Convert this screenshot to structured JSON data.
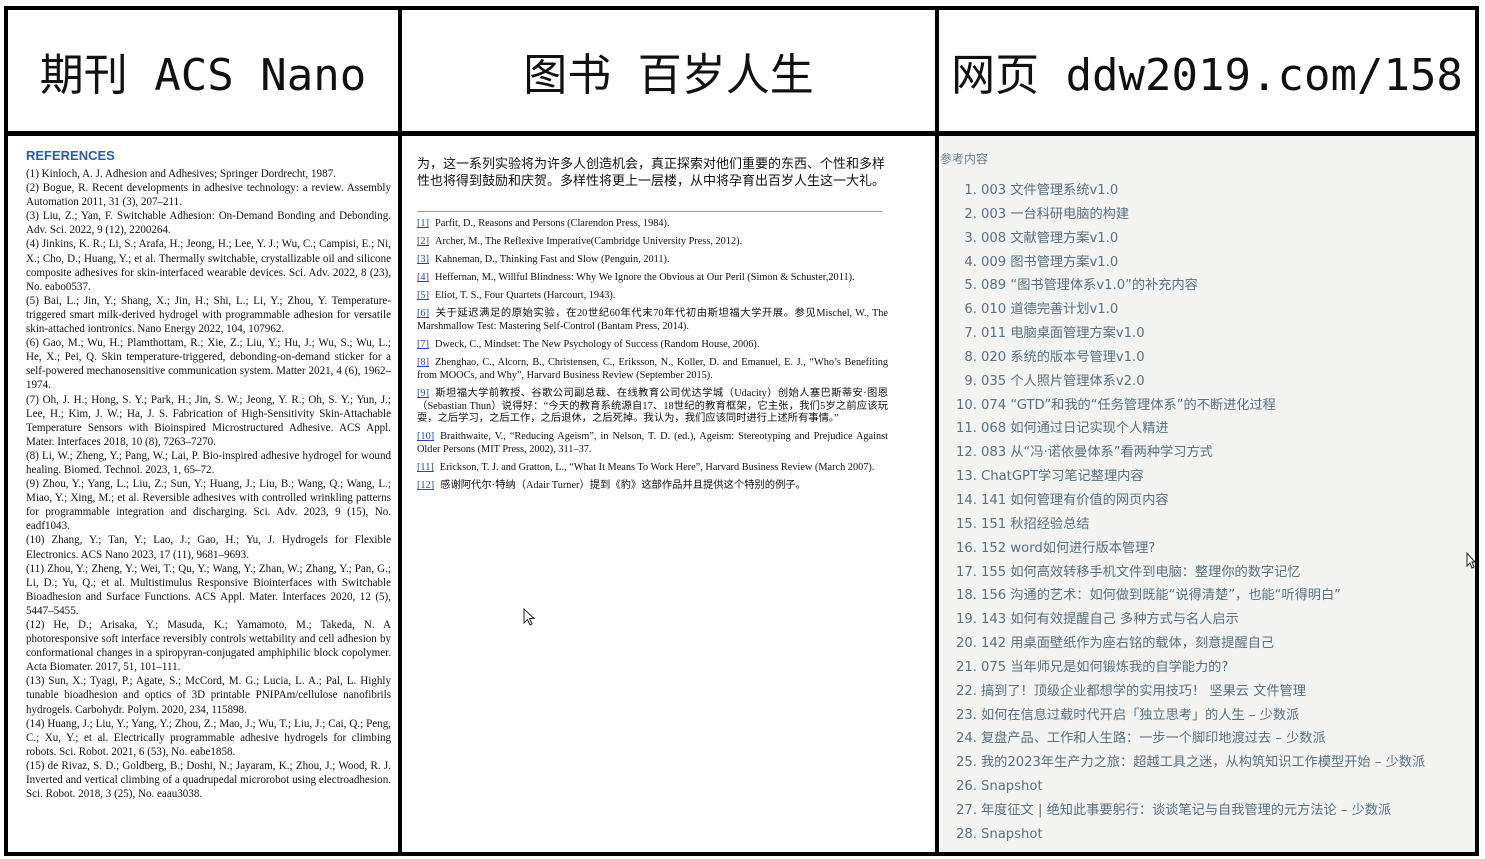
{
  "headers": {
    "journal": "期刊 ACS Nano",
    "book": "图书 百岁人生",
    "web": "网页 ddw2019.com/158"
  },
  "journal": {
    "section_title": "REFERENCES",
    "refs": [
      "(1) Kinloch, A. J. Adhesion and Adhesives; Springer Dordrecht, 1987.",
      "(2) Bogue, R. Recent developments in adhesive technology: a review. Assembly Automation 2011, 31 (3), 207–211.",
      "(3) Liu, Z.; Yan, F. Switchable Adhesion: On-Demand Bonding and Debonding. Adv. Sci. 2022, 9 (12), 2200264.",
      "(4) Jinkins, K. R.; Li, S.; Arafa, H.; Jeong, H.; Lee, Y. J.; Wu, C.; Campisi, E.; Ni, X.; Cho, D.; Huang, Y.; et al. Thermally switchable, crystallizable oil and silicone composite adhesives for skin-interfaced wearable devices. Sci. Adv. 2022, 8 (23), No. eabo0537.",
      "(5) Bai, L.; Jin, Y.; Shang, X.; Jin, H.; Shi, L.; Li, Y.; Zhou, Y. Temperature-triggered smart milk-derived hydrogel with programmable adhesion for versatile skin-attached iontronics. Nano Energy 2022, 104, 107962.",
      "(6) Gao, M.; Wu, H.; Plamthottam, R.; Xie, Z.; Liu, Y.; Hu, J.; Wu, S.; Wu, L.; He, X.; Pei, Q. Skin temperature-triggered, debonding-on-demand sticker for a self-powered mechanosensitive communication system. Matter 2021, 4 (6), 1962–1974.",
      "(7) Oh, J. H.; Hong, S. Y.; Park, H.; Jin, S. W.; Jeong, Y. R.; Oh, S. Y.; Yun, J.; Lee, H.; Kim, J. W.; Ha, J. S. Fabrication of High-Sensitivity Skin-Attachable Temperature Sensors with Bioinspired Microstructured Adhesive. ACS Appl. Mater. Interfaces 2018, 10 (8), 7263–7270.",
      "(8) Li, W.; Zheng, Y.; Pang, W.; Lai, P. Bio-inspired adhesive hydrogel for wound healing. Biomed. Technol. 2023, 1, 65–72.",
      "(9) Zhou, Y.; Yang, L.; Liu, Z.; Sun, Y.; Huang, J.; Liu, B.; Wang, Q.; Wang, L.; Miao, Y.; Xing, M.; et al. Reversible adhesives with controlled wrinkling patterns for programmable integration and discharging. Sci. Adv. 2023, 9 (15), No. eadf1043.",
      "(10) Zhang, Y.; Tan, Y.; Lao, J.; Gao, H.; Yu, J. Hydrogels for Flexible Electronics. ACS Nano 2023, 17 (11), 9681–9693.",
      "(11) Zhou, Y.; Zheng, Y.; Wei, T.; Qu, Y.; Wang, Y.; Zhan, W.; Zhang, Y.; Pan, G.; Li, D.; Yu, Q.; et al. Multistimulus Responsive Biointerfaces with Switchable Bioadhesion and Surface Functions. ACS Appl. Mater. Interfaces 2020, 12 (5), 5447–5455.",
      "(12) He, D.; Arisaka, Y.; Masuda, K.; Yamamoto, M.; Takeda, N. A photoresponsive soft interface reversibly controls wettability and cell adhesion by conformational changes in a spiropyran-conjugated amphiphilic block copolymer. Acta Biomater. 2017, 51, 101–111.",
      "(13) Sun, X.; Tyagi, P.; Agate, S.; McCord, M. G.; Lucia, L. A.; Pal, L. Highly tunable bioadhesion and optics of 3D printable PNIPAm/cellulose nanofibrils hydrogels. Carbohydr. Polym. 2020, 234, 115898.",
      "(14) Huang, J.; Liu, Y.; Yang, Y.; Zhou, Z.; Mao, J.; Wu, T.; Liu, J.; Cai, Q.; Peng, C.; Xu, Y.; et al. Electrically programmable adhesive hydrogels for climbing robots. Sci. Robot. 2021, 6 (53), No. eabe1858.",
      "(15) de Rivaz, S. D.; Goldberg, B.; Doshi, N.; Jayaram, K.; Zhou, J.; Wood, R. J. Inverted and vertical climbing of a quadrupedal microrobot using electroadhesion. Sci. Robot. 2018, 3 (25), No. eaau3038."
    ]
  },
  "book": {
    "paragraph": "为，这一系列实验将为许多人创造机会，真正探索对他们重要的东西、个性和多样性也将得到鼓励和庆贺。多样性将更上一层楼，从中将孕育出百岁人生这一大礼。",
    "notes": [
      {
        "num": "[1]",
        "text": "Parfit, D., Reasons and Persons (Clarendon Press, 1984)."
      },
      {
        "num": "[2]",
        "text": "Archer, M., The Reflexive Imperative(Cambridge University Press, 2012)."
      },
      {
        "num": "[3]",
        "text": "Kahneman, D., Thinking Fast and Slow (Penguin, 2011)."
      },
      {
        "num": "[4]",
        "text": "Heffernan, M., Willful Blindness: Why We Ignore the Obvious at Our Peril (Simon & Schuster,2011)."
      },
      {
        "num": "[5]",
        "text": "Eliot, T. S., Four Quartets (Harcourt, 1943)."
      },
      {
        "num": "[6]",
        "text": "关于延迟满足的原始实验，在20世纪60年代末70年代初由斯坦福大学开展。参见Mischel, W., The Marshmallow Test: Mastering Self-Control (Bantam Press, 2014)."
      },
      {
        "num": "[7]",
        "text": "Dweck, C., Mindset: The New Psychology of Success (Random House, 2006)."
      },
      {
        "num": "[8]",
        "text": "Zhenghao, C., Alcorn, B., Christensen, C., Eriksson, N., Koller, D. and Emanuel, E. J., “Who’s Benefiting from MOOCs, and Why”, Harvard Business Review (September 2015)."
      },
      {
        "num": "[9]",
        "text": "斯坦福大学前教授、谷歌公司副总裁、在线教育公司优达学城（Udacity）创始人塞巴斯蒂安·图恩（Sebastian Thun）说得好：“今天的教育系统源自17、18世纪的教育框架，它主张，我们5岁之前应该玩耍，之后学习，之后工作，之后退休，之后死掉。我认为，我们应该同时进行上述所有事情。”"
      },
      {
        "num": "[10]",
        "text": "Braithwaite, V., “Reducing Ageism”, in Nelson, T. D. (ed.), Ageism: Stereotyping and Prejudice Against Older Persons (MIT Press, 2002), 311–37."
      },
      {
        "num": "[11]",
        "text": "Erickson, T. J. and Gratton, L., “What It Means To Work Here”, Harvard Business Review (March 2007)."
      },
      {
        "num": "[12]",
        "text": "感谢阿代尔·特纳（Adair Turner）提到《豹》这部作品并且提供这个特别的例子。"
      }
    ]
  },
  "web": {
    "page_title": "参考内容",
    "items": [
      {
        "idx": "1.",
        "label": "003 文件管理系统v1.0"
      },
      {
        "idx": "2.",
        "label": "003 一台科研电脑的构建"
      },
      {
        "idx": "3.",
        "label": "008 文献管理方案v1.0"
      },
      {
        "idx": "4.",
        "label": "009 图书管理方案v1.0"
      },
      {
        "idx": "5.",
        "label": "089 “图书管理体系v1.0”的补充内容"
      },
      {
        "idx": "6.",
        "label": "010 道德完善计划v1.0"
      },
      {
        "idx": "7.",
        "label": "011 电脑桌面管理方案v1.0"
      },
      {
        "idx": "8.",
        "label": "020 系统的版本号管理v1.0"
      },
      {
        "idx": "9.",
        "label": "035 个人照片管理体系v2.0"
      },
      {
        "idx": "10.",
        "label": "074 “GTD”和我的“任务管理体系”的不断进化过程"
      },
      {
        "idx": "11.",
        "label": "068 如何通过日记实现个人精进"
      },
      {
        "idx": "12.",
        "label": "083 从“冯·诺依曼体系”看两种学习方式"
      },
      {
        "idx": "13.",
        "label": "ChatGPT学习笔记整理内容"
      },
      {
        "idx": "14.",
        "label": "141 如何管理有价值的网页内容"
      },
      {
        "idx": "15.",
        "label": "151 秋招经验总结"
      },
      {
        "idx": "16.",
        "label": "152 word如何进行版本管理?"
      },
      {
        "idx": "17.",
        "label": "155 如何高效转移手机文件到电脑：整理你的数字记忆"
      },
      {
        "idx": "18.",
        "label": "156 沟通的艺术：如何做到既能“说得清楚”，也能“听得明白”"
      },
      {
        "idx": "19.",
        "label": "143 如何有效提醒自己 多种方式与名人启示"
      },
      {
        "idx": "20.",
        "label": "142 用桌面壁纸作为座右铭的载体，刻意提醒自己"
      },
      {
        "idx": "21.",
        "label": "075 当年师兄是如何锻炼我的自学能力的?"
      },
      {
        "idx": "22.",
        "label": "搞到了！顶级企业都想学的实用技巧！ 坚果云 文件管理"
      },
      {
        "idx": "23.",
        "label": "如何在信息过载时代开启「独立思考」的人生 – 少数派"
      },
      {
        "idx": "24.",
        "label": "复盘产品、工作和人生路：一步一个脚印地渡过去 – 少数派"
      },
      {
        "idx": "25.",
        "label": "我的2023年生产力之旅：超越工具之迷，从构筑知识工作模型开始 – 少数派"
      },
      {
        "idx": "26.",
        "label": "Snapshot"
      },
      {
        "idx": "27.",
        "label": "年度征文 | 绝知此事要躬行：谈谈笔记与自我管理的元方法论 – 少数派"
      },
      {
        "idx": "28.",
        "label": "Snapshot"
      }
    ]
  }
}
